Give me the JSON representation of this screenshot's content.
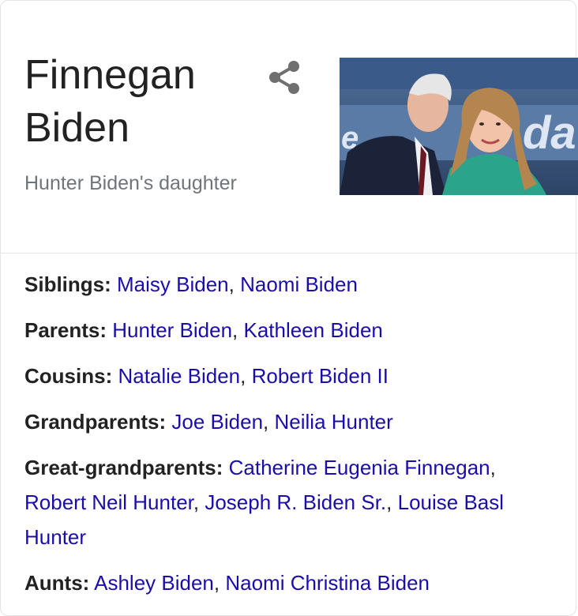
{
  "entity": {
    "title": "Finnegan Biden",
    "subtitle": "Hunter Biden's daughter",
    "share_icon": "share-icon"
  },
  "facts": [
    {
      "label": "Siblings:",
      "links": [
        "Maisy Biden",
        "Naomi Biden"
      ]
    },
    {
      "label": "Parents:",
      "links": [
        "Hunter Biden",
        "Kathleen Biden"
      ]
    },
    {
      "label": "Cousins:",
      "links": [
        "Natalie Biden",
        "Robert Biden II"
      ]
    },
    {
      "label": "Grandparents:",
      "links": [
        "Joe Biden",
        "Neilia Hunter"
      ]
    },
    {
      "label": "Great-grandparents:",
      "links": [
        "Catherine Eugenia Finnegan",
        "Robert Neil Hunter",
        "Joseph R. Biden Sr.",
        "Louise Basl Hunter"
      ]
    },
    {
      "label": "Aunts:",
      "links": [
        "Ashley Biden",
        "Naomi Christina Biden"
      ]
    }
  ],
  "colors": {
    "link": "#1a0dab",
    "text": "#222222",
    "muted": "#70757a"
  }
}
